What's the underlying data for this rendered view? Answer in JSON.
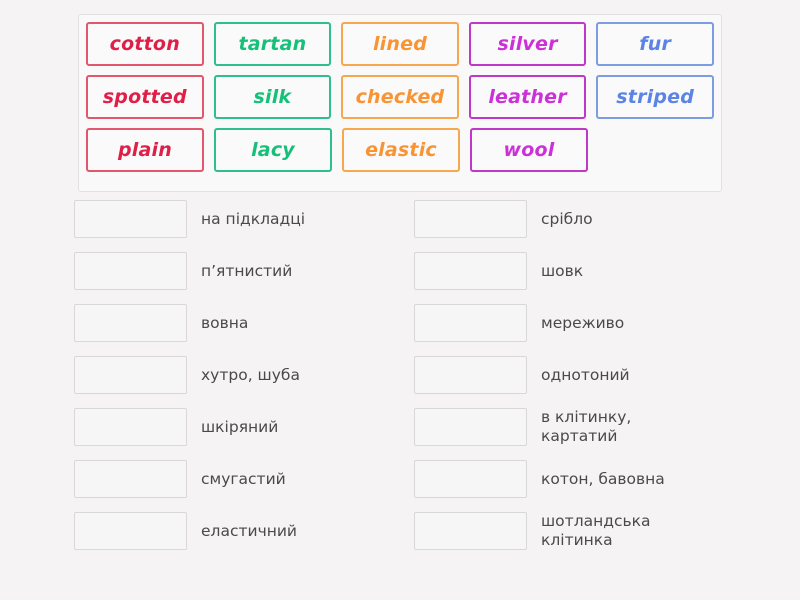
{
  "activity": {
    "type": "match-up",
    "colors": {
      "red": "#e01f49",
      "green": "#16c079",
      "orange": "#f99434",
      "purple": "#cc30d8",
      "blue": "#5b84e6",
      "background": "#f5f3f4",
      "drop_zone_border": "#d9d7d8",
      "panel_border": "#e2e0e1",
      "label_text": "#4a4a4a"
    }
  },
  "tile_bank": {
    "rows": [
      [
        {
          "label": "cotton",
          "color": "red"
        },
        {
          "label": "tartan",
          "color": "green"
        },
        {
          "label": "lined",
          "color": "orange"
        },
        {
          "label": "silver",
          "color": "purple"
        },
        {
          "label": "fur",
          "color": "blue"
        }
      ],
      [
        {
          "label": "spotted",
          "color": "red"
        },
        {
          "label": "silk",
          "color": "green"
        },
        {
          "label": "checked",
          "color": "orange"
        },
        {
          "label": "leather",
          "color": "purple"
        },
        {
          "label": "striped",
          "color": "blue"
        }
      ],
      [
        {
          "label": "plain",
          "color": "red"
        },
        {
          "label": "lacy",
          "color": "green"
        },
        {
          "label": "elastic",
          "color": "orange"
        },
        {
          "label": "wool",
          "color": "purple"
        }
      ]
    ]
  },
  "match_columns": {
    "left": [
      {
        "answer": "",
        "definition": "на підкладці"
      },
      {
        "answer": "",
        "definition": "п’ятнистий"
      },
      {
        "answer": "",
        "definition": "вовна"
      },
      {
        "answer": "",
        "definition": "хутро, шуба"
      },
      {
        "answer": "",
        "definition": "шкіряний"
      },
      {
        "answer": "",
        "definition": "смугастий"
      },
      {
        "answer": "",
        "definition": "еластичний"
      }
    ],
    "right": [
      {
        "answer": "",
        "definition": "срібло"
      },
      {
        "answer": "",
        "definition": "шовк"
      },
      {
        "answer": "",
        "definition": "мереживо"
      },
      {
        "answer": "",
        "definition": "однотоний"
      },
      {
        "answer": "",
        "definition": "в клітинку,\nкартатий"
      },
      {
        "answer": "",
        "definition": "котон, бавовна"
      },
      {
        "answer": "",
        "definition": "шотландська\nклітинка"
      }
    ]
  }
}
